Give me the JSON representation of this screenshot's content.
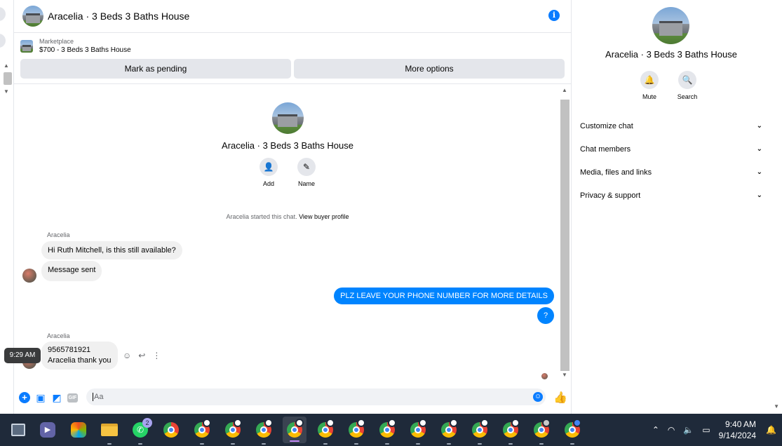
{
  "chat": {
    "title": "Aracelia · 3 Beds 3 Baths House",
    "marketplace_label": "Marketplace",
    "listing": "$700 - 3 Beds 3 Baths House",
    "btn_pending": "Mark as pending",
    "btn_more": "More options",
    "intro_name": "Aracelia · 3 Beds 3 Baths House",
    "act_add": "Add",
    "act_name": "Name",
    "started_text": "Aracelia started this chat.",
    "view_profile": "View buyer profile",
    "sender1": "Aracelia",
    "msg1": "Hi Ruth Mitchell, is this still available?",
    "msg2": "Message sent",
    "out1": "PLZ LEAVE YOUR PHONE NUMBER FOR MORE DETAILS",
    "out2": "?",
    "sender2": "Aracelia",
    "msg3_line1": "9565781921",
    "msg3_line2": "Aracelia thank you",
    "tooltip_time": "9:29 AM",
    "input_placeholder": "Aa"
  },
  "side": {
    "title": "Aracelia · 3 Beds 3 Baths House",
    "mute": "Mute",
    "search": "Search",
    "menu": [
      "Customize chat",
      "Chat members",
      "Media, files and links",
      "Privacy & support"
    ]
  },
  "taskbar": {
    "whatsapp_badge": "2",
    "time": "9:40 AM",
    "date": "9/14/2024"
  },
  "colors": {
    "accent": "#0084ff",
    "taskbar": "#1f2a3a"
  }
}
